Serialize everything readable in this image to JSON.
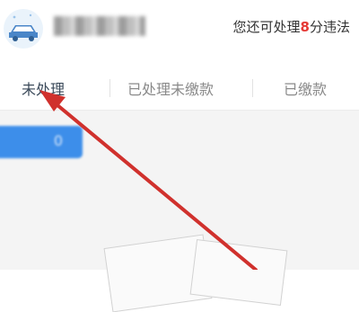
{
  "header": {
    "quota_prefix": "您还可处理",
    "quota_number": "8",
    "quota_suffix": "分违法"
  },
  "tabs": [
    {
      "label": "未处理",
      "active": true
    },
    {
      "label": "已处理未缴款",
      "active": false
    },
    {
      "label": "已缴款",
      "active": false
    }
  ],
  "action_button": {
    "label": "0"
  },
  "colors": {
    "accent": "#3d8eea",
    "quota_number": "#e53935",
    "annotation_arrow": "#d0312d"
  },
  "icons": [
    "car-icon",
    "annotation-arrow"
  ]
}
